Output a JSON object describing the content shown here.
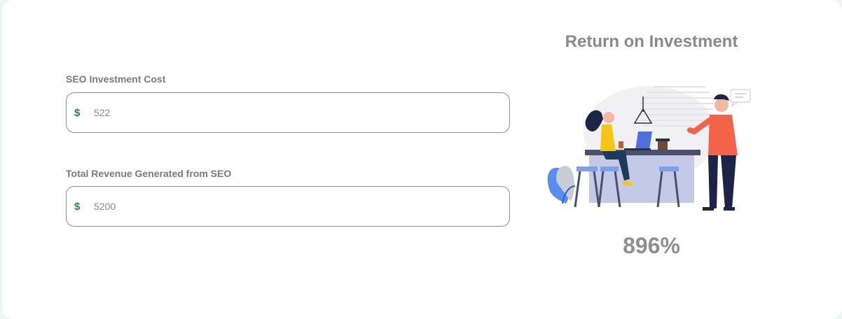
{
  "form": {
    "investment": {
      "label": "SEO Investment Cost",
      "currency_symbol": "$",
      "value": "522"
    },
    "revenue": {
      "label": "Total Revenue Generated from SEO",
      "currency_symbol": "$",
      "value": "5200"
    }
  },
  "result": {
    "title": "Return on Investment",
    "value": "896",
    "unit": "%"
  },
  "colors": {
    "currency": "#1f8a3c",
    "text_muted": "#8a8a8a",
    "border": "#8d8d8d"
  },
  "icons": {
    "illustration": "office-coffee-bar-illustration"
  }
}
